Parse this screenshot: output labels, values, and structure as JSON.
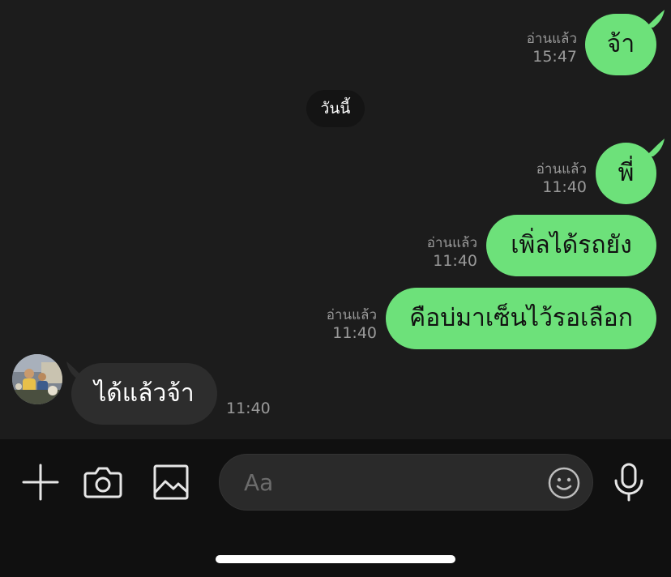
{
  "colors": {
    "background": "#1c1c1c",
    "outgoing_bubble": "#6de17a",
    "incoming_bubble": "#2d2d2d",
    "meta_text": "#9a9a9a",
    "composer_bg": "#101010"
  },
  "messages": {
    "outgoing": [
      {
        "text": "จ้า",
        "status": "อ่านแล้ว",
        "time": "15:47"
      },
      {
        "text": "พี่",
        "status": "อ่านแล้ว",
        "time": "11:40"
      },
      {
        "text": "เพิ่ลได้รถยัง",
        "status": "อ่านแล้ว",
        "time": "11:40"
      },
      {
        "text": "คือบ่มาเซ็นไว้รอเลือก",
        "status": "อ่านแล้ว",
        "time": "11:40"
      }
    ],
    "incoming": [
      {
        "text": "ได้แล้วจ้า",
        "time": "11:40"
      }
    ]
  },
  "date_separator": "วันนี้",
  "composer": {
    "placeholder": "Aa",
    "icons": [
      "plus-icon",
      "camera-icon",
      "image-icon",
      "emoji-icon",
      "microphone-icon"
    ]
  }
}
